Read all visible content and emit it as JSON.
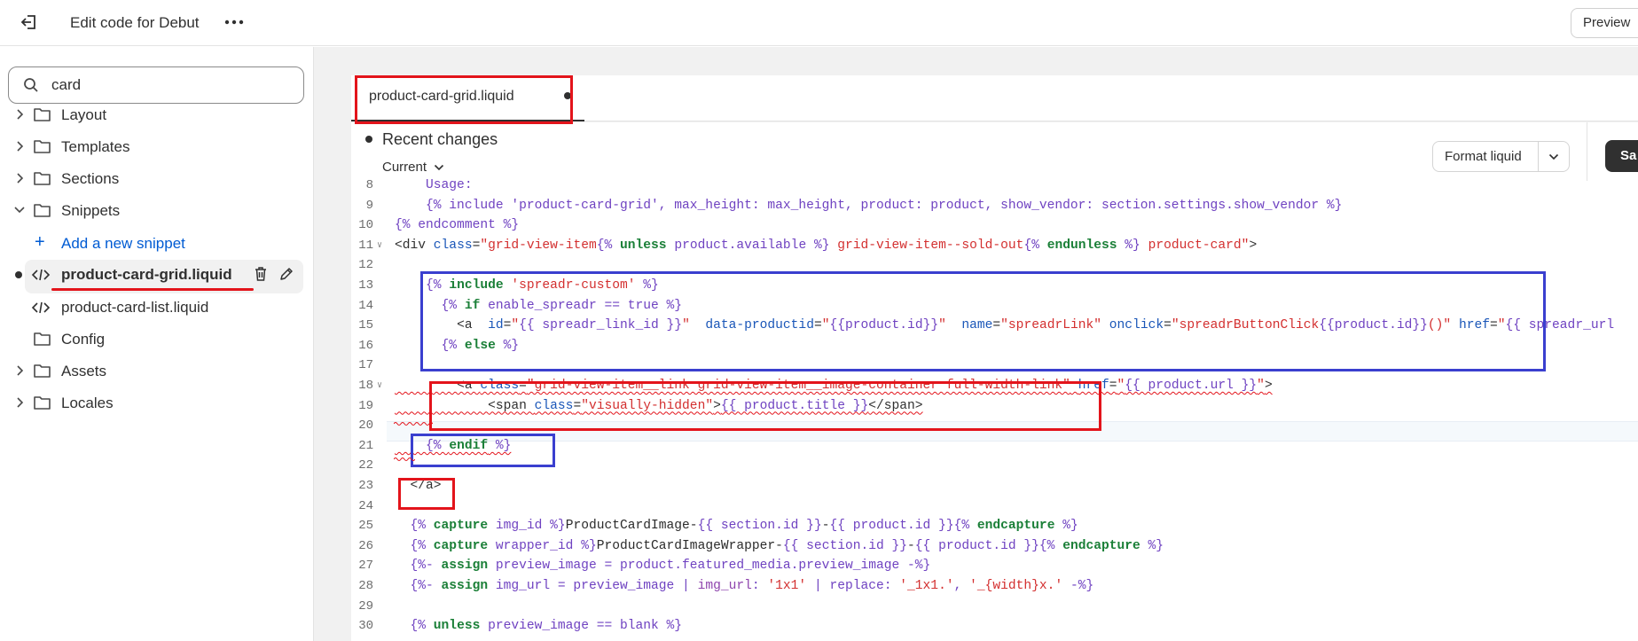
{
  "header": {
    "title": "Edit code for Debut",
    "preview_label": "Preview"
  },
  "sidebar": {
    "search_value": "card",
    "folders": [
      {
        "label": "Layout"
      },
      {
        "label": "Templates"
      },
      {
        "label": "Sections"
      },
      {
        "label": "Snippets"
      }
    ],
    "add_snippet_label": "Add a new snippet",
    "files": [
      {
        "label": "product-card-grid.liquid"
      },
      {
        "label": "product-card-list.liquid"
      }
    ],
    "more_folders": [
      {
        "label": "Config"
      },
      {
        "label": "Assets"
      },
      {
        "label": "Locales"
      }
    ]
  },
  "tab": {
    "label": "product-card-grid.liquid"
  },
  "panel": {
    "recent_changes": "Recent changes",
    "current_label": "Current",
    "format_label": "Format liquid",
    "save_label": "Sa"
  },
  "code": {
    "line_numbers": [
      "8",
      "9",
      "10",
      "11",
      "12",
      "13",
      "14",
      "15",
      "16",
      "17",
      "18",
      "19",
      "20",
      "21",
      "22",
      "23",
      "24",
      "25",
      "26",
      "27",
      "28",
      "29",
      "30"
    ]
  }
}
